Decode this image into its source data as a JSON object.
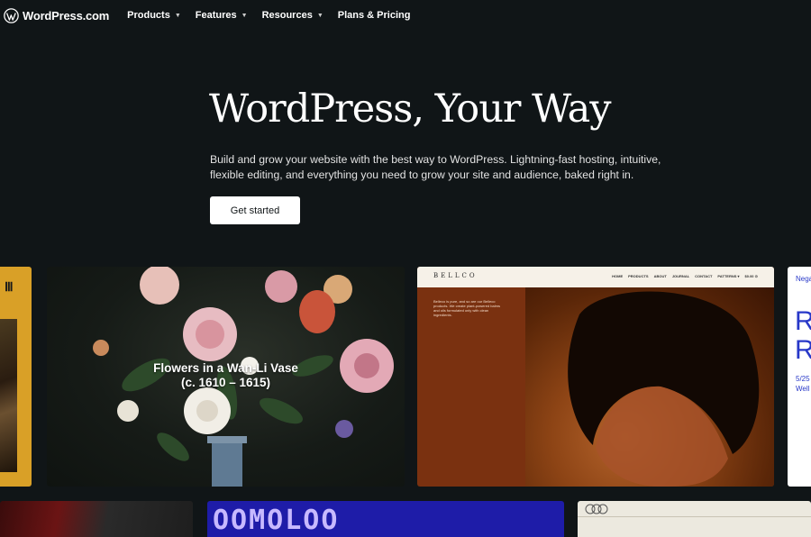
{
  "nav": {
    "logo_text": "WordPress.com",
    "items": [
      {
        "label": "Products",
        "has_caret": true
      },
      {
        "label": "Features",
        "has_caret": true
      },
      {
        "label": "Resources",
        "has_caret": true
      },
      {
        "label": "Plans & Pricing",
        "has_caret": false
      }
    ],
    "caret": "▼"
  },
  "hero": {
    "title": "WordPress, Your Way",
    "subtitle": "Build and grow your website with the best way to WordPress. Lightning-fast hosting, intuitive, flexible editing, and everything you need to grow your site and audience, baked right in.",
    "cta_label": "Get started"
  },
  "showcase": {
    "flowers_title_line1": "Flowers in a Wan-Li Vase",
    "flowers_title_line2": "(c. 1610 – 1615)",
    "belleco": {
      "brand": "BELLCO",
      "links": [
        "HOME",
        "PRODUCTS",
        "ABOUT",
        "JOURNAL",
        "CONTACT",
        "PATTERNS ▾",
        "$0.00 ⊙"
      ],
      "intro": "Belleco is pure, and so are our Belleco products. We create plant-powered balms and oils formulated only with clean ingredients."
    },
    "white_card": {
      "nav": "Nega",
      "big1": "R",
      "big2": "R",
      "date_line1": "5/25",
      "date_line2": "Well"
    },
    "blue_card_text": "OOMOLOO"
  },
  "colors": {
    "background": "#101517",
    "cta_bg": "#ffffff",
    "yellow_card": "#d9a027",
    "belleco_orange": "#7a3110",
    "blue_card": "#1e1ca8",
    "white_card_accent": "#2838c8"
  }
}
